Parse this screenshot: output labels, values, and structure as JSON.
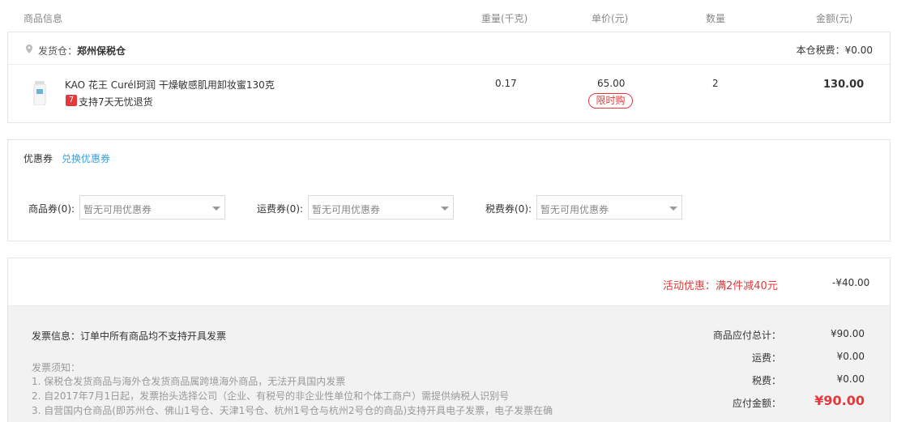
{
  "header": {
    "product_info": "商品信息",
    "weight": "重量(千克)",
    "unit_price": "单价(元)",
    "quantity": "数量",
    "amount": "金额(元)"
  },
  "warehouse": {
    "label": "发货仓：",
    "name": "郑州保税仓",
    "tax": "本仓税费：¥0.00"
  },
  "product": {
    "name": "KAO 花王 Curél珂润 干燥敏感肌用卸妆蜜130克",
    "badge": "7",
    "return_policy": "支持7天无忧退货",
    "weight": "0.17",
    "price": "65.00",
    "tag": "限时购",
    "quantity": "2",
    "amount": "130.00"
  },
  "coupons": {
    "title": "优惠券",
    "exchange_link": "兑换优惠券",
    "product": {
      "label": "商品券(0):",
      "value": "暂无可用优惠券"
    },
    "shipping": {
      "label": "运费券(0):",
      "value": "暂无可用优惠券"
    },
    "tax": {
      "label": "税费券(0):",
      "value": "暂无可用优惠券"
    }
  },
  "promotion": {
    "label": "活动优惠：满2件减40元",
    "amount": "-¥40.00"
  },
  "invoice": {
    "info": "发票信息：订单中所有商品均不支持开具发票",
    "notes_title": "发票须知：",
    "notes": [
      "1. 保税仓发货商品与海外仓发货商品属跨境海外商品，无法开具国内发票",
      "2. 自2017年7月1日起，发票抬头选择公司（企业、有税号的非企业性单位和个体工商户）需提供纳税人识别号",
      "3. 自营国内仓商品(即苏州仓、佛山1号仓、天津1号仓、杭州1号仓与杭州2号仓的商品)支持开具电子发票，电子发票在确"
    ]
  },
  "totals": {
    "goods_label": "商品应付总计：",
    "goods_value": "¥90.00",
    "shipping_label": "运费：",
    "shipping_value": "¥0.00",
    "tax_label": "税费：",
    "tax_value": "¥0.00",
    "payable_label": "应付金额：",
    "payable_value": "¥90.00"
  },
  "colors": {
    "accent_red": "#e4393c",
    "link_blue": "#3b9fdc"
  }
}
